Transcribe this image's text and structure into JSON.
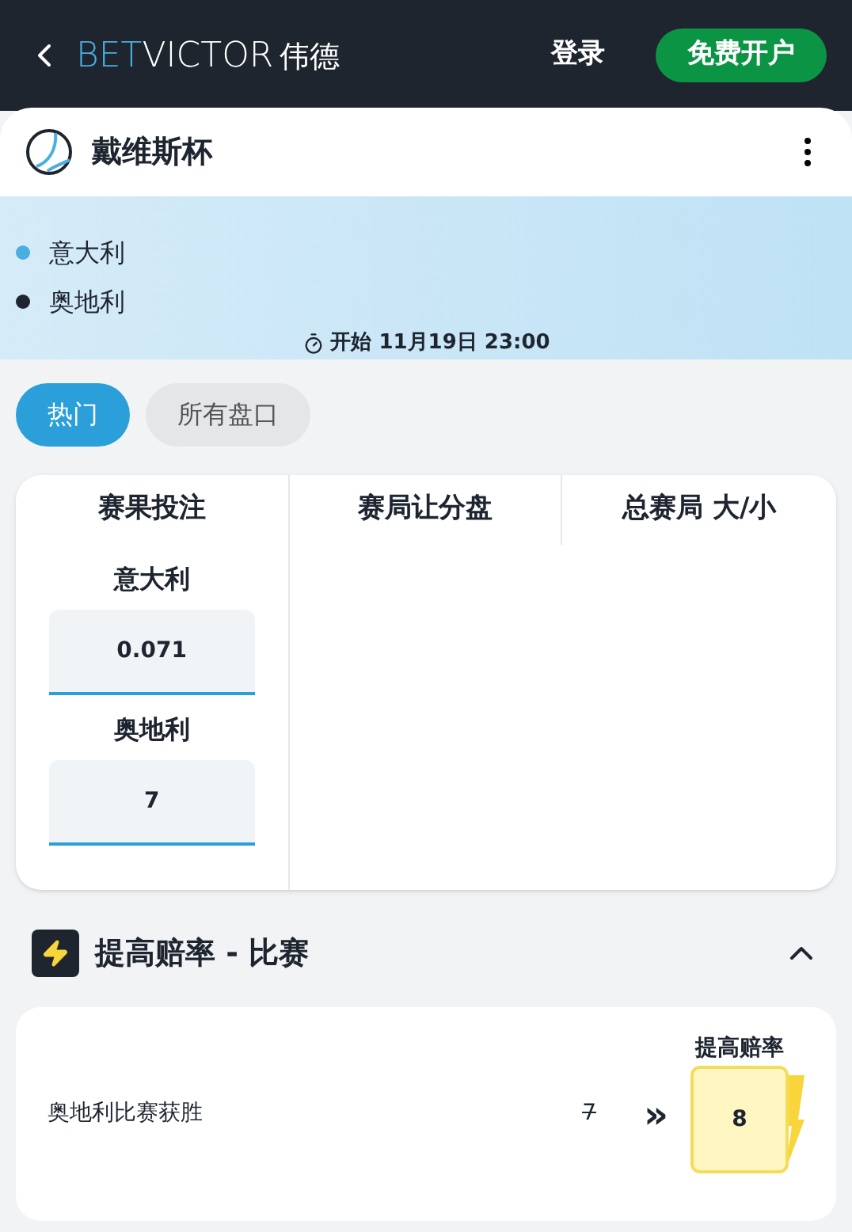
{
  "header": {
    "logo": {
      "part1": "BET",
      "part2": "VICTOR",
      "part3": "伟德"
    },
    "login": "登录",
    "signup": "免费开户"
  },
  "event": {
    "title": "戴维斯杯",
    "teams": [
      {
        "name": "意大利",
        "color": "#4aaee0"
      },
      {
        "name": "奥地利",
        "color": "#1e2530"
      }
    ],
    "start": "开始 11月19日 23:00"
  },
  "tabs": [
    {
      "label": "热门",
      "selected": true
    },
    {
      "label": "所有盘口",
      "selected": false
    }
  ],
  "markets": {
    "columns": [
      "赛果投注",
      "赛局让分盘",
      "总赛局 大/小"
    ],
    "selections": [
      {
        "name": "意大利",
        "odds": "0.071"
      },
      {
        "name": "奥地利",
        "odds": "7"
      }
    ]
  },
  "boost": {
    "title": "提高赔率 - 比赛",
    "expanded": true,
    "label": "提高赔率",
    "rows": [
      {
        "name": "奥地利比赛获胜",
        "old_odds": "7",
        "arrows": "»",
        "new_odds": "8"
      }
    ]
  }
}
